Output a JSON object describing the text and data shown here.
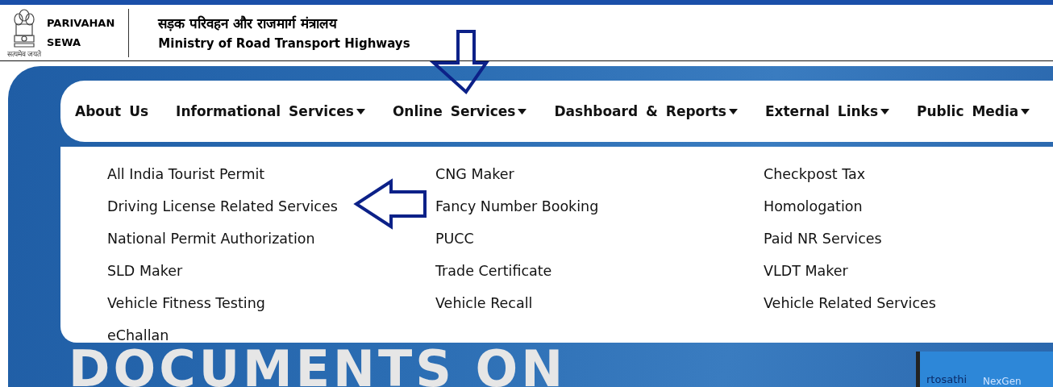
{
  "header": {
    "emblem_motto": "सत्यमेव जयते",
    "brand_line_1": "PARIVAHAN",
    "brand_line_2": "SEWA",
    "ministry_hindi": "सड़क परिवहन और राजमार्ग मंत्रालय",
    "ministry_english": "Ministry of Road Transport Highways"
  },
  "nav": [
    {
      "label": "About Us",
      "has_dropdown": false
    },
    {
      "label": "Informational Services",
      "has_dropdown": true
    },
    {
      "label": "Online Services",
      "has_dropdown": true
    },
    {
      "label": "Dashboard & Reports",
      "has_dropdown": true
    },
    {
      "label": "External Links",
      "has_dropdown": true
    },
    {
      "label": "Public Media",
      "has_dropdown": true
    }
  ],
  "dropdown": {
    "columns": [
      [
        "All India Tourist Permit",
        "Driving License Related Services",
        "National Permit Authorization",
        "SLD Maker",
        "Vehicle Fitness Testing",
        "eChallan"
      ],
      [
        "CNG Maker",
        "Fancy Number Booking",
        "PUCC",
        "Trade Certificate",
        "Vehicle Recall"
      ],
      [
        "Checkpost Tax",
        "Homologation",
        "Paid NR Services",
        "VLDT Maker",
        "Vehicle Related Services"
      ]
    ]
  },
  "hero": {
    "headline": "DOCUMENTS ON",
    "phone_texts": [
      "rtosathi",
      "NexGen"
    ]
  }
}
